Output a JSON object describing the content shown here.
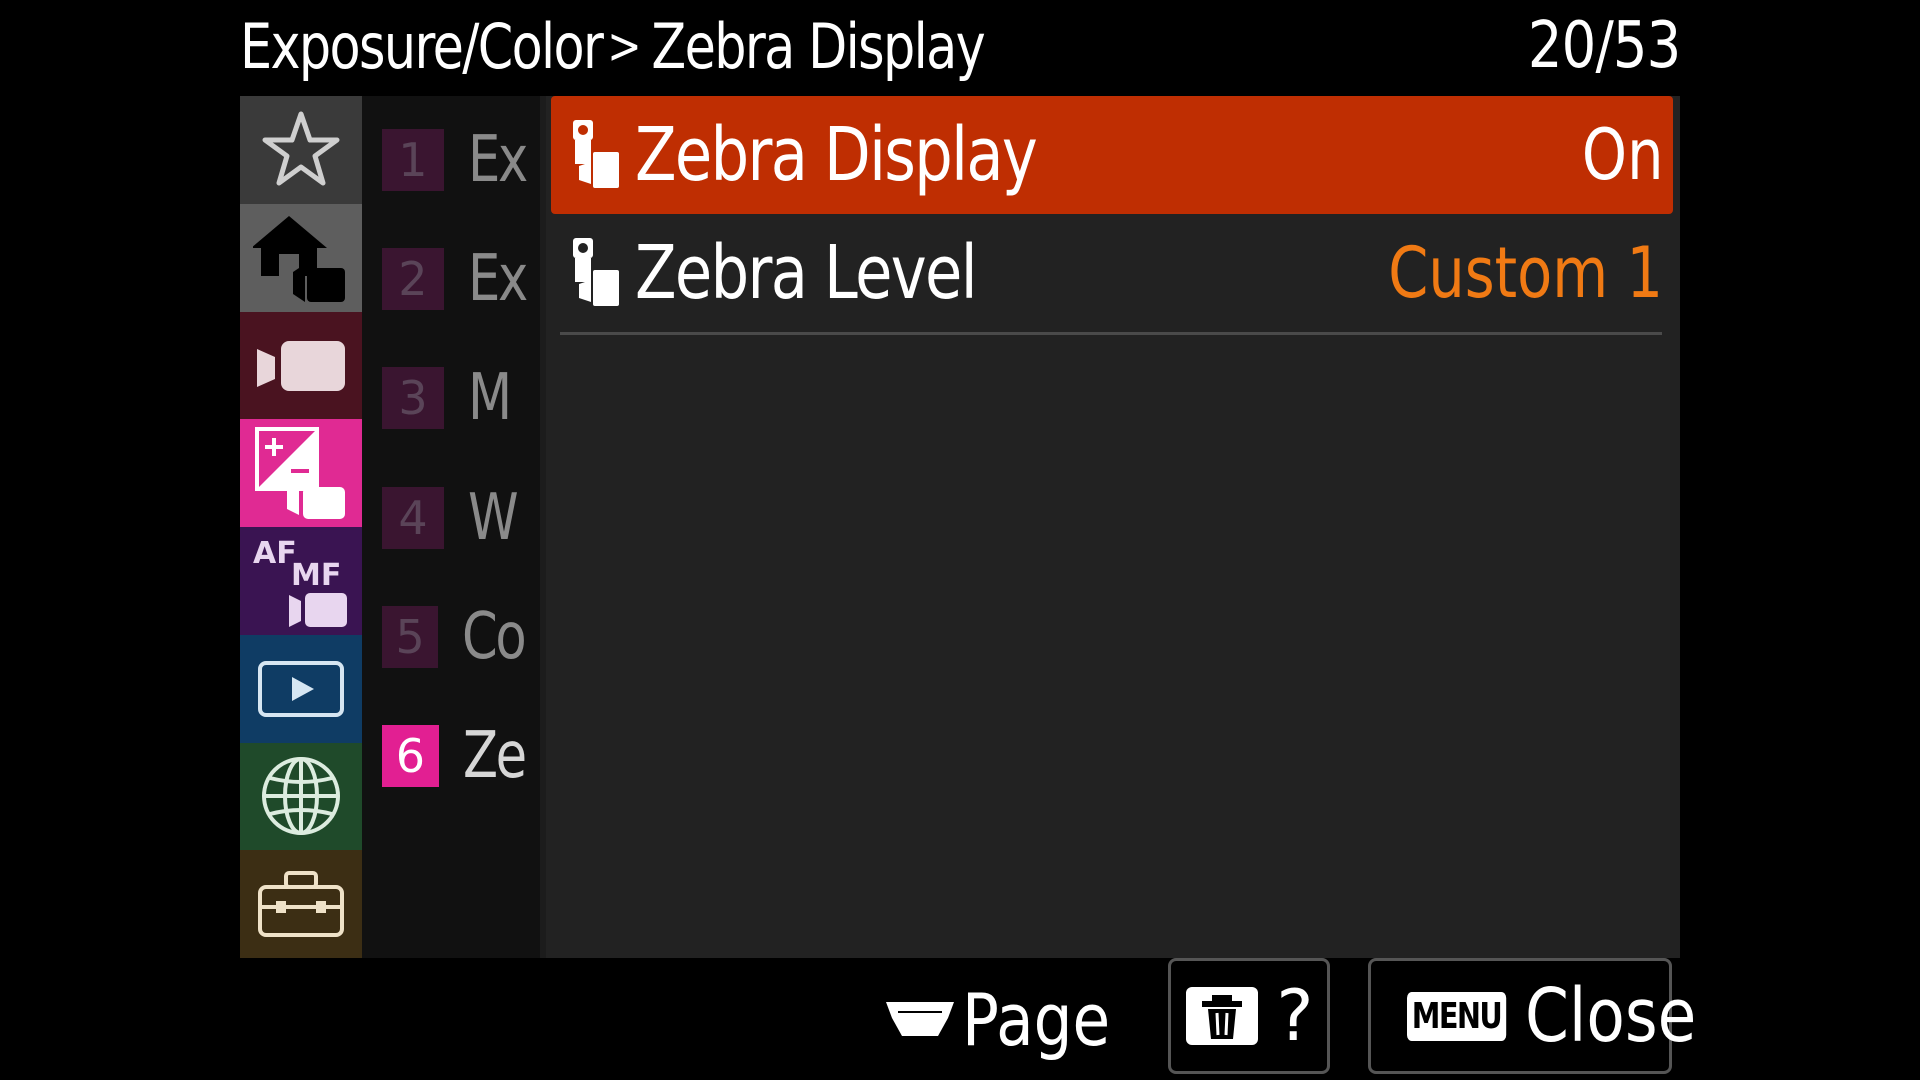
{
  "header": {
    "category": "Exposure/Color",
    "separator": ">",
    "current": "Zebra Display",
    "page_counter": "20/53"
  },
  "tabs": [
    {
      "name": "my-menu-tab",
      "icon": "star-icon",
      "color": "#3a3a3a"
    },
    {
      "name": "shooting-tab",
      "icon": "camera-home-icon",
      "color": "#5e5e5e"
    },
    {
      "name": "movie-tab",
      "icon": "movie-camera-icon",
      "color": "#4a1320"
    },
    {
      "name": "exposure-color-tab",
      "icon": "exposure-comp-icon",
      "color": "#e02a93",
      "active": true
    },
    {
      "name": "focus-tab",
      "icon": "af-mf-icon",
      "color": "#3a1452",
      "af": "AF",
      "mf": "MF"
    },
    {
      "name": "playback-tab",
      "icon": "playback-icon",
      "color": "#0f3c64"
    },
    {
      "name": "network-tab",
      "icon": "globe-icon",
      "color": "#1f4a2a"
    },
    {
      "name": "setup-tab",
      "icon": "toolbox-icon",
      "color": "#3c2e14"
    }
  ],
  "sub_tabs": [
    {
      "num": "1",
      "label": "Ex"
    },
    {
      "num": "2",
      "label": "Ex"
    },
    {
      "num": "3",
      "label": "M"
    },
    {
      "num": "4",
      "label": "W"
    },
    {
      "num": "5",
      "label": "Co"
    },
    {
      "num": "6",
      "label": "Ze",
      "active": true
    }
  ],
  "rows": [
    {
      "label": "Zebra Display",
      "value": "On",
      "selected": true
    },
    {
      "label": "Zebra Level",
      "value": "Custom 1",
      "selected": false
    }
  ],
  "footer": {
    "page_label": "Page",
    "help_label": "?",
    "menu_badge": "MENU",
    "close_label": "Close"
  },
  "colors": {
    "accent_selected": "#bf2e02",
    "value_orange": "#f07a14",
    "active_tab_pink": "#e21f92"
  }
}
